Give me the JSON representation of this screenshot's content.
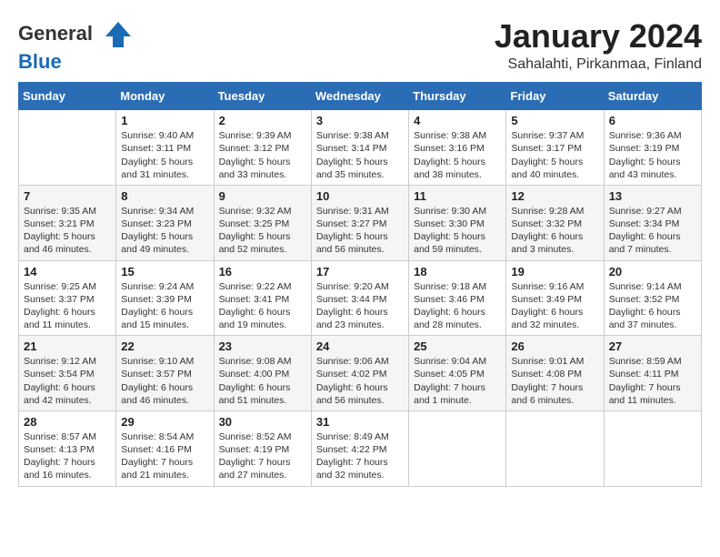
{
  "header": {
    "logo_line1": "General",
    "logo_line2": "Blue",
    "month": "January 2024",
    "location": "Sahalahti, Pirkanmaa, Finland"
  },
  "weekdays": [
    "Sunday",
    "Monday",
    "Tuesday",
    "Wednesday",
    "Thursday",
    "Friday",
    "Saturday"
  ],
  "weeks": [
    [
      {
        "day": "",
        "detail": ""
      },
      {
        "day": "1",
        "detail": "Sunrise: 9:40 AM\nSunset: 3:11 PM\nDaylight: 5 hours\nand 31 minutes."
      },
      {
        "day": "2",
        "detail": "Sunrise: 9:39 AM\nSunset: 3:12 PM\nDaylight: 5 hours\nand 33 minutes."
      },
      {
        "day": "3",
        "detail": "Sunrise: 9:38 AM\nSunset: 3:14 PM\nDaylight: 5 hours\nand 35 minutes."
      },
      {
        "day": "4",
        "detail": "Sunrise: 9:38 AM\nSunset: 3:16 PM\nDaylight: 5 hours\nand 38 minutes."
      },
      {
        "day": "5",
        "detail": "Sunrise: 9:37 AM\nSunset: 3:17 PM\nDaylight: 5 hours\nand 40 minutes."
      },
      {
        "day": "6",
        "detail": "Sunrise: 9:36 AM\nSunset: 3:19 PM\nDaylight: 5 hours\nand 43 minutes."
      }
    ],
    [
      {
        "day": "7",
        "detail": "Sunrise: 9:35 AM\nSunset: 3:21 PM\nDaylight: 5 hours\nand 46 minutes."
      },
      {
        "day": "8",
        "detail": "Sunrise: 9:34 AM\nSunset: 3:23 PM\nDaylight: 5 hours\nand 49 minutes."
      },
      {
        "day": "9",
        "detail": "Sunrise: 9:32 AM\nSunset: 3:25 PM\nDaylight: 5 hours\nand 52 minutes."
      },
      {
        "day": "10",
        "detail": "Sunrise: 9:31 AM\nSunset: 3:27 PM\nDaylight: 5 hours\nand 56 minutes."
      },
      {
        "day": "11",
        "detail": "Sunrise: 9:30 AM\nSunset: 3:30 PM\nDaylight: 5 hours\nand 59 minutes."
      },
      {
        "day": "12",
        "detail": "Sunrise: 9:28 AM\nSunset: 3:32 PM\nDaylight: 6 hours\nand 3 minutes."
      },
      {
        "day": "13",
        "detail": "Sunrise: 9:27 AM\nSunset: 3:34 PM\nDaylight: 6 hours\nand 7 minutes."
      }
    ],
    [
      {
        "day": "14",
        "detail": "Sunrise: 9:25 AM\nSunset: 3:37 PM\nDaylight: 6 hours\nand 11 minutes."
      },
      {
        "day": "15",
        "detail": "Sunrise: 9:24 AM\nSunset: 3:39 PM\nDaylight: 6 hours\nand 15 minutes."
      },
      {
        "day": "16",
        "detail": "Sunrise: 9:22 AM\nSunset: 3:41 PM\nDaylight: 6 hours\nand 19 minutes."
      },
      {
        "day": "17",
        "detail": "Sunrise: 9:20 AM\nSunset: 3:44 PM\nDaylight: 6 hours\nand 23 minutes."
      },
      {
        "day": "18",
        "detail": "Sunrise: 9:18 AM\nSunset: 3:46 PM\nDaylight: 6 hours\nand 28 minutes."
      },
      {
        "day": "19",
        "detail": "Sunrise: 9:16 AM\nSunset: 3:49 PM\nDaylight: 6 hours\nand 32 minutes."
      },
      {
        "day": "20",
        "detail": "Sunrise: 9:14 AM\nSunset: 3:52 PM\nDaylight: 6 hours\nand 37 minutes."
      }
    ],
    [
      {
        "day": "21",
        "detail": "Sunrise: 9:12 AM\nSunset: 3:54 PM\nDaylight: 6 hours\nand 42 minutes."
      },
      {
        "day": "22",
        "detail": "Sunrise: 9:10 AM\nSunset: 3:57 PM\nDaylight: 6 hours\nand 46 minutes."
      },
      {
        "day": "23",
        "detail": "Sunrise: 9:08 AM\nSunset: 4:00 PM\nDaylight: 6 hours\nand 51 minutes."
      },
      {
        "day": "24",
        "detail": "Sunrise: 9:06 AM\nSunset: 4:02 PM\nDaylight: 6 hours\nand 56 minutes."
      },
      {
        "day": "25",
        "detail": "Sunrise: 9:04 AM\nSunset: 4:05 PM\nDaylight: 7 hours\nand 1 minute."
      },
      {
        "day": "26",
        "detail": "Sunrise: 9:01 AM\nSunset: 4:08 PM\nDaylight: 7 hours\nand 6 minutes."
      },
      {
        "day": "27",
        "detail": "Sunrise: 8:59 AM\nSunset: 4:11 PM\nDaylight: 7 hours\nand 11 minutes."
      }
    ],
    [
      {
        "day": "28",
        "detail": "Sunrise: 8:57 AM\nSunset: 4:13 PM\nDaylight: 7 hours\nand 16 minutes."
      },
      {
        "day": "29",
        "detail": "Sunrise: 8:54 AM\nSunset: 4:16 PM\nDaylight: 7 hours\nand 21 minutes."
      },
      {
        "day": "30",
        "detail": "Sunrise: 8:52 AM\nSunset: 4:19 PM\nDaylight: 7 hours\nand 27 minutes."
      },
      {
        "day": "31",
        "detail": "Sunrise: 8:49 AM\nSunset: 4:22 PM\nDaylight: 7 hours\nand 32 minutes."
      },
      {
        "day": "",
        "detail": ""
      },
      {
        "day": "",
        "detail": ""
      },
      {
        "day": "",
        "detail": ""
      }
    ]
  ]
}
